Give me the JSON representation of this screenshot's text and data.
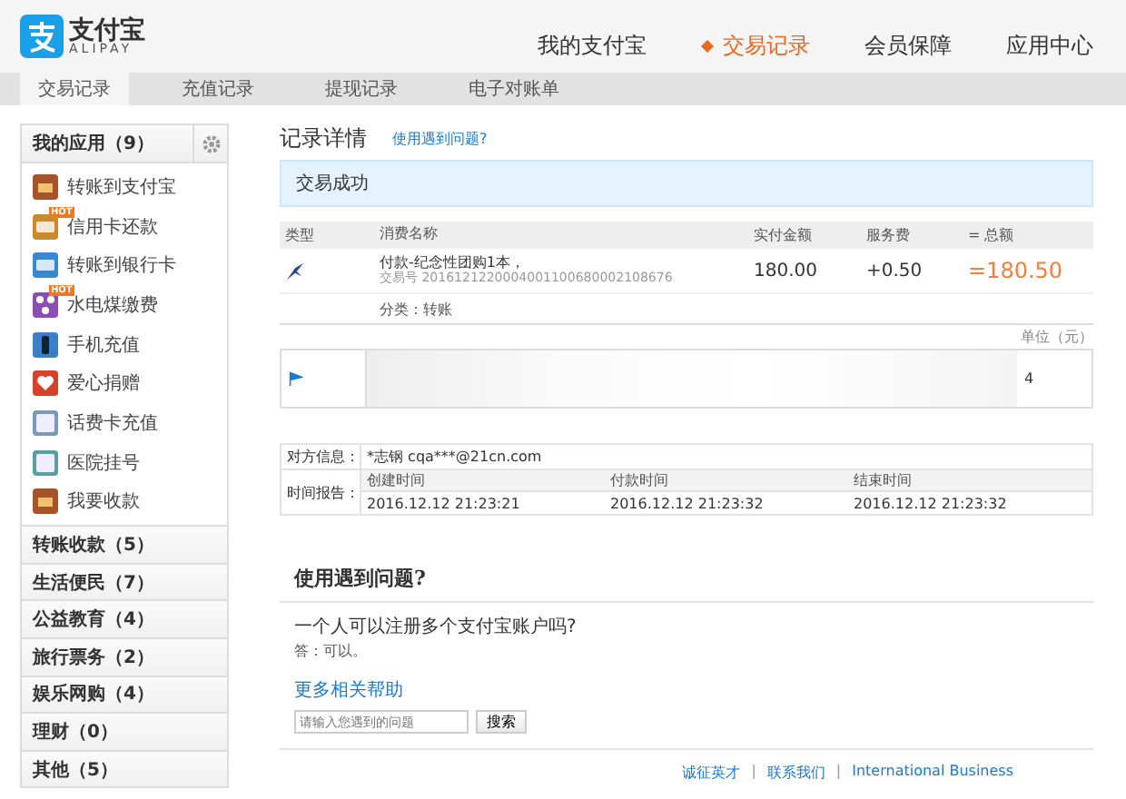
{
  "logo": {
    "name": "支付宝",
    "sub": "ALIPAY"
  },
  "nav": [
    {
      "label": "我的支付宝",
      "selected": false
    },
    {
      "label": "交易记录",
      "selected": true
    },
    {
      "label": "会员保障",
      "selected": false
    },
    {
      "label": "应用中心",
      "selected": false
    }
  ],
  "subnav": [
    {
      "label": "交易记录",
      "selected": true
    },
    {
      "label": "充值记录",
      "selected": false
    },
    {
      "label": "提现记录",
      "selected": false
    },
    {
      "label": "电子对账单",
      "selected": false
    }
  ],
  "sidebar": {
    "title": "我的应用（9）",
    "apps": [
      {
        "label": "转账到支付宝",
        "kind": "chest"
      },
      {
        "label": "信用卡还款",
        "kind": "card",
        "badge": "HOT"
      },
      {
        "label": "转账到银行卡",
        "kind": "bank"
      },
      {
        "label": "水电煤缴费",
        "kind": "utility",
        "badge": "HOT"
      },
      {
        "label": "手机充值",
        "kind": "phone"
      },
      {
        "label": "爱心捐赠",
        "kind": "heart"
      },
      {
        "label": "话费卡充值",
        "kind": "topup"
      },
      {
        "label": "医院挂号",
        "kind": "hospital"
      },
      {
        "label": "我要收款",
        "kind": "chest"
      }
    ],
    "categories": [
      "转账收款（5）",
      "生活便民（7）",
      "公益教育（4）",
      "旅行票务（2）",
      "娱乐网购（4）",
      "理财（0）",
      "其他（5）"
    ]
  },
  "detail": {
    "title": "记录详情",
    "help_link": "使用遇到问题?",
    "status": "交易成功",
    "columns": [
      "类型",
      "消费名称",
      "实付金额",
      "服务费",
      "= 总额"
    ],
    "row": {
      "name": "付款-纪念性团购1本，",
      "trade_no": "交易号 2016121220004001100680002108676",
      "paid": "180.00",
      "fee": "+0.50",
      "total": "=180.50"
    },
    "category": "分类：转账",
    "unit": "单位（元）",
    "partial": "4",
    "counterpart_label": "对方信息：",
    "counterpart": "*志钢 cqa***@21cn.com",
    "time_label": "时间报告：",
    "times": [
      {
        "label": "创建时间",
        "value": "2016.12.12 21:23:21"
      },
      {
        "label": "付款时间",
        "value": "2016.12.12 21:23:32"
      },
      {
        "label": "结束时间",
        "value": "2016.12.12 21:23:32"
      }
    ]
  },
  "faq": {
    "title": "使用遇到问题?",
    "question": "一个人可以注册多个支付宝账户吗?",
    "answer": "答：可以。",
    "more": "更多相关帮助",
    "placeholder": "请输入您遇到的问题",
    "button": "搜索"
  },
  "footer": {
    "links": [
      "诚征英才",
      "联系我们",
      "International Business"
    ],
    "separator": "|"
  }
}
